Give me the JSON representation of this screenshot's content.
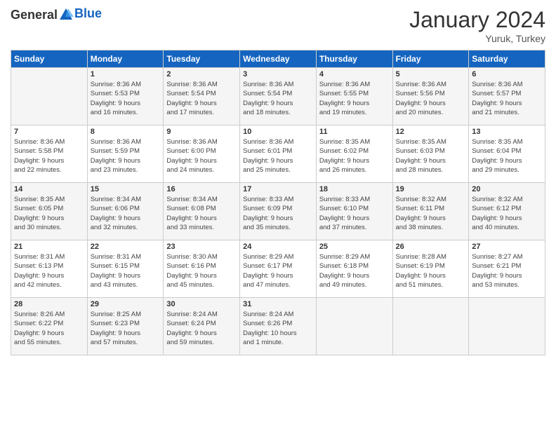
{
  "header": {
    "logo_general": "General",
    "logo_blue": "Blue",
    "month_title": "January 2024",
    "location": "Yuruk, Turkey"
  },
  "days_of_week": [
    "Sunday",
    "Monday",
    "Tuesday",
    "Wednesday",
    "Thursday",
    "Friday",
    "Saturday"
  ],
  "weeks": [
    [
      {
        "day": "",
        "info": ""
      },
      {
        "day": "1",
        "info": "Sunrise: 8:36 AM\nSunset: 5:53 PM\nDaylight: 9 hours\nand 16 minutes."
      },
      {
        "day": "2",
        "info": "Sunrise: 8:36 AM\nSunset: 5:54 PM\nDaylight: 9 hours\nand 17 minutes."
      },
      {
        "day": "3",
        "info": "Sunrise: 8:36 AM\nSunset: 5:54 PM\nDaylight: 9 hours\nand 18 minutes."
      },
      {
        "day": "4",
        "info": "Sunrise: 8:36 AM\nSunset: 5:55 PM\nDaylight: 9 hours\nand 19 minutes."
      },
      {
        "day": "5",
        "info": "Sunrise: 8:36 AM\nSunset: 5:56 PM\nDaylight: 9 hours\nand 20 minutes."
      },
      {
        "day": "6",
        "info": "Sunrise: 8:36 AM\nSunset: 5:57 PM\nDaylight: 9 hours\nand 21 minutes."
      }
    ],
    [
      {
        "day": "7",
        "info": "Sunrise: 8:36 AM\nSunset: 5:58 PM\nDaylight: 9 hours\nand 22 minutes."
      },
      {
        "day": "8",
        "info": "Sunrise: 8:36 AM\nSunset: 5:59 PM\nDaylight: 9 hours\nand 23 minutes."
      },
      {
        "day": "9",
        "info": "Sunrise: 8:36 AM\nSunset: 6:00 PM\nDaylight: 9 hours\nand 24 minutes."
      },
      {
        "day": "10",
        "info": "Sunrise: 8:36 AM\nSunset: 6:01 PM\nDaylight: 9 hours\nand 25 minutes."
      },
      {
        "day": "11",
        "info": "Sunrise: 8:35 AM\nSunset: 6:02 PM\nDaylight: 9 hours\nand 26 minutes."
      },
      {
        "day": "12",
        "info": "Sunrise: 8:35 AM\nSunset: 6:03 PM\nDaylight: 9 hours\nand 28 minutes."
      },
      {
        "day": "13",
        "info": "Sunrise: 8:35 AM\nSunset: 6:04 PM\nDaylight: 9 hours\nand 29 minutes."
      }
    ],
    [
      {
        "day": "14",
        "info": "Sunrise: 8:35 AM\nSunset: 6:05 PM\nDaylight: 9 hours\nand 30 minutes."
      },
      {
        "day": "15",
        "info": "Sunrise: 8:34 AM\nSunset: 6:06 PM\nDaylight: 9 hours\nand 32 minutes."
      },
      {
        "day": "16",
        "info": "Sunrise: 8:34 AM\nSunset: 6:08 PM\nDaylight: 9 hours\nand 33 minutes."
      },
      {
        "day": "17",
        "info": "Sunrise: 8:33 AM\nSunset: 6:09 PM\nDaylight: 9 hours\nand 35 minutes."
      },
      {
        "day": "18",
        "info": "Sunrise: 8:33 AM\nSunset: 6:10 PM\nDaylight: 9 hours\nand 37 minutes."
      },
      {
        "day": "19",
        "info": "Sunrise: 8:32 AM\nSunset: 6:11 PM\nDaylight: 9 hours\nand 38 minutes."
      },
      {
        "day": "20",
        "info": "Sunrise: 8:32 AM\nSunset: 6:12 PM\nDaylight: 9 hours\nand 40 minutes."
      }
    ],
    [
      {
        "day": "21",
        "info": "Sunrise: 8:31 AM\nSunset: 6:13 PM\nDaylight: 9 hours\nand 42 minutes."
      },
      {
        "day": "22",
        "info": "Sunrise: 8:31 AM\nSunset: 6:15 PM\nDaylight: 9 hours\nand 43 minutes."
      },
      {
        "day": "23",
        "info": "Sunrise: 8:30 AM\nSunset: 6:16 PM\nDaylight: 9 hours\nand 45 minutes."
      },
      {
        "day": "24",
        "info": "Sunrise: 8:29 AM\nSunset: 6:17 PM\nDaylight: 9 hours\nand 47 minutes."
      },
      {
        "day": "25",
        "info": "Sunrise: 8:29 AM\nSunset: 6:18 PM\nDaylight: 9 hours\nand 49 minutes."
      },
      {
        "day": "26",
        "info": "Sunrise: 8:28 AM\nSunset: 6:19 PM\nDaylight: 9 hours\nand 51 minutes."
      },
      {
        "day": "27",
        "info": "Sunrise: 8:27 AM\nSunset: 6:21 PM\nDaylight: 9 hours\nand 53 minutes."
      }
    ],
    [
      {
        "day": "28",
        "info": "Sunrise: 8:26 AM\nSunset: 6:22 PM\nDaylight: 9 hours\nand 55 minutes."
      },
      {
        "day": "29",
        "info": "Sunrise: 8:25 AM\nSunset: 6:23 PM\nDaylight: 9 hours\nand 57 minutes."
      },
      {
        "day": "30",
        "info": "Sunrise: 8:24 AM\nSunset: 6:24 PM\nDaylight: 9 hours\nand 59 minutes."
      },
      {
        "day": "31",
        "info": "Sunrise: 8:24 AM\nSunset: 6:26 PM\nDaylight: 10 hours\nand 1 minute."
      },
      {
        "day": "",
        "info": ""
      },
      {
        "day": "",
        "info": ""
      },
      {
        "day": "",
        "info": ""
      }
    ]
  ]
}
